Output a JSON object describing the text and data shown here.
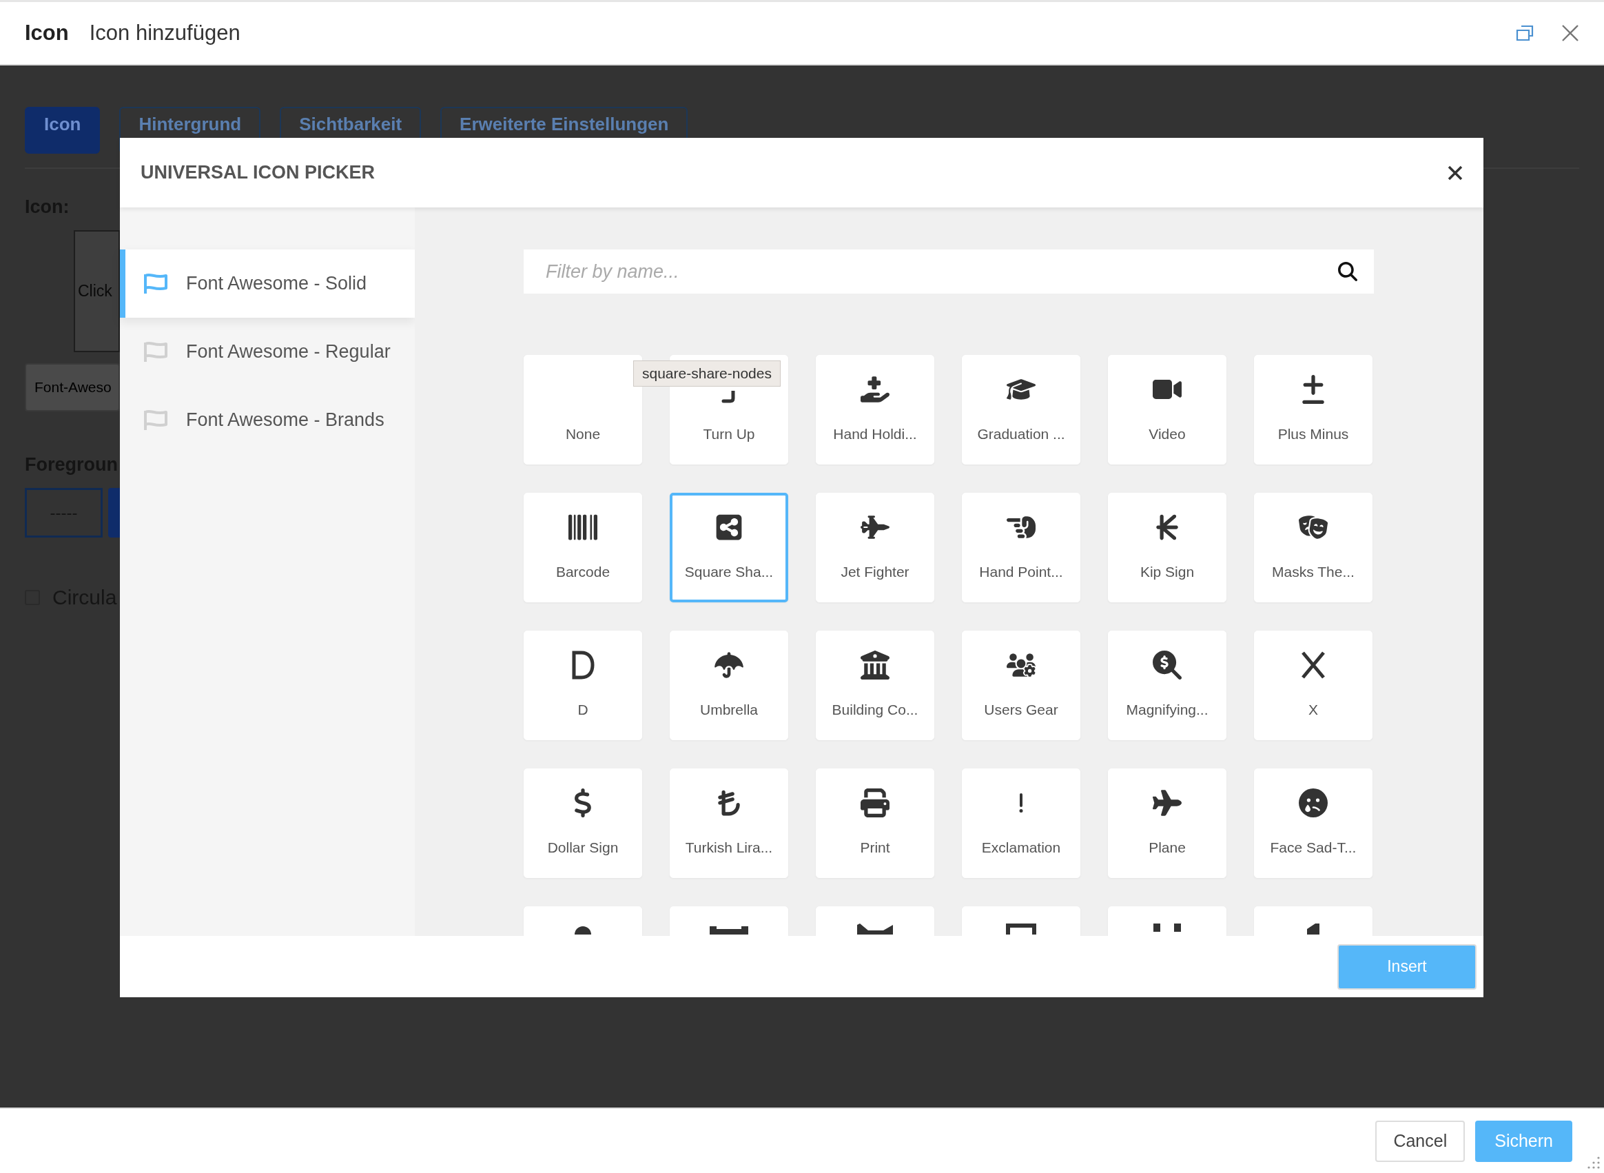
{
  "window": {
    "title": "Icon",
    "subtitle": "Icon hinzufügen"
  },
  "background": {
    "tabs": [
      {
        "label": "Icon",
        "selected": true
      },
      {
        "label": "Hintergrund",
        "selected": false
      },
      {
        "label": "Sichtbarkeit",
        "selected": false
      },
      {
        "label": "Erweiterte Einstellungen",
        "selected": false
      }
    ],
    "icon_label": "Icon:",
    "icon_box_text": "Click",
    "icon_field_value": "Font-Aweso",
    "foreground_label": "Foregroun",
    "foreground_value": "-----",
    "circular": {
      "label": "Circula",
      "checked": false
    }
  },
  "picker": {
    "title": "UNIVERSAL ICON PICKER",
    "sets": [
      {
        "label": "Font Awesome - Solid",
        "selected": true
      },
      {
        "label": "Font Awesome - Regular",
        "selected": false
      },
      {
        "label": "Font Awesome - Brands",
        "selected": false
      }
    ],
    "search": {
      "placeholder": "Filter by name..."
    },
    "tooltip": "square-share-nodes",
    "icons": [
      {
        "label": "None",
        "selected": false
      },
      {
        "label": "Turn Up",
        "selected": false
      },
      {
        "label": "Hand Holdi...",
        "selected": false
      },
      {
        "label": "Graduation ...",
        "selected": false
      },
      {
        "label": "Video",
        "selected": false
      },
      {
        "label": "Plus Minus",
        "selected": false
      },
      {
        "label": "Barcode",
        "selected": false
      },
      {
        "label": "Square Sha...",
        "selected": true
      },
      {
        "label": "Jet Fighter",
        "selected": false
      },
      {
        "label": "Hand Point...",
        "selected": false
      },
      {
        "label": "Kip Sign",
        "selected": false
      },
      {
        "label": "Masks The...",
        "selected": false
      },
      {
        "label": "D",
        "selected": false
      },
      {
        "label": "Umbrella",
        "selected": false
      },
      {
        "label": "Building Co...",
        "selected": false
      },
      {
        "label": "Users Gear",
        "selected": false
      },
      {
        "label": "Magnifying...",
        "selected": false
      },
      {
        "label": "X",
        "selected": false
      },
      {
        "label": "Dollar Sign",
        "selected": false
      },
      {
        "label": "Turkish Lira...",
        "selected": false
      },
      {
        "label": "Print",
        "selected": false
      },
      {
        "label": "Exclamation",
        "selected": false
      },
      {
        "label": "Plane",
        "selected": false
      },
      {
        "label": "Face Sad-T...",
        "selected": false
      }
    ],
    "cut_row": [
      {
        "kind": "glyph"
      },
      {
        "kind": "glyph"
      },
      {
        "kind": "glyph"
      },
      {
        "kind": "glyph"
      },
      {
        "kind": "glyph"
      },
      {
        "kind": "glyph"
      }
    ],
    "insert_button": "Insert"
  },
  "footer": {
    "buttons": [
      {
        "label": "Cancel",
        "kind": "secondary"
      },
      {
        "label": "Sichern",
        "kind": "primary"
      }
    ]
  }
}
